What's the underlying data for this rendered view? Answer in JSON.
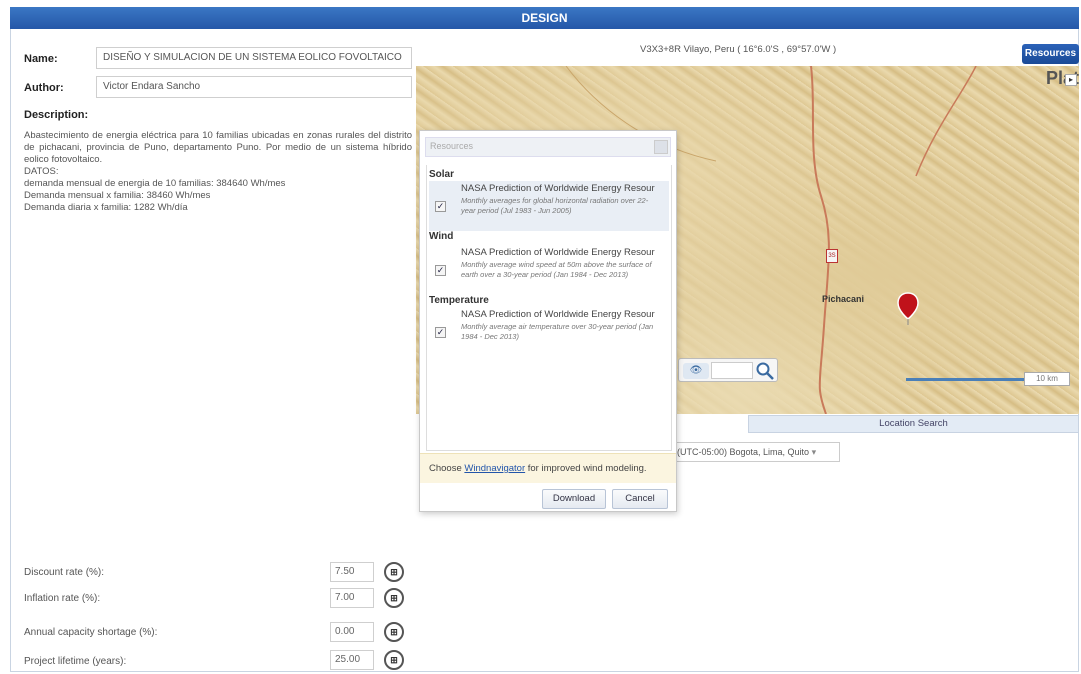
{
  "header": {
    "title": "DESIGN"
  },
  "form": {
    "name_label": "Name:",
    "name_value": "DISEÑO Y SIMULACION DE UN SISTEMA EOLICO FOVOLTAICO",
    "author_label": "Author:",
    "author_value": "Victor Endara Sancho",
    "description_label": "Description:",
    "description_lines": [
      "Abastecimiento de energia eléctrica para 10 familias ubicadas en zonas rurales del distrito de pichacani, provincia de Puno, departamento Puno. Por medio de un sistema híbrido eolico fotovoltaico.",
      "DATOS:",
      "demanda mensual de energia de 10 familias: 384640 Wh/mes",
      "Demanda mensual x familia: 38460 Wh/mes",
      "Demanda diaria x familia: 1282 Wh/día"
    ]
  },
  "economics": [
    {
      "label": "Discount rate (%):",
      "value": "7.50"
    },
    {
      "label": "Inflation rate (%):",
      "value": "7.00"
    },
    {
      "label": "Annual capacity shortage (%):",
      "value": "0.00"
    },
    {
      "label": "Project lifetime (years):",
      "value": "25.00"
    }
  ],
  "location": {
    "coords": "V3X3+8R Vilayo, Peru ( 16°6.0'S , 69°57.0'W )",
    "resources_button": "Resources",
    "map_label": "Plat",
    "place_name": "Pichacani",
    "road_number": "3S",
    "scale_label": "10 km",
    "search_button": "Location Search",
    "timezone": "(UTC-05:00) Bogota, Lima, Quito"
  },
  "dialog": {
    "header_placeholder": "Resources",
    "sections": [
      {
        "title": "Solar",
        "item_title": "NASA Prediction of Worldwide Energy Resour",
        "item_desc": "Monthly averages for global horizontal radiation over 22-year period (Jul 1983 - Jun 2005)",
        "checked": true
      },
      {
        "title": "Wind",
        "item_title": "NASA Prediction of Worldwide Energy Resour",
        "item_desc": "Monthly average wind speed at 50m above the surface of earth over a 30-year period (Jan 1984 - Dec 2013)",
        "checked": true
      },
      {
        "title": "Temperature",
        "item_title": "NASA Prediction of Worldwide Energy Resour",
        "item_desc": "Monthly average air temperature over 30-year period (Jan 1984 - Dec 2013)",
        "checked": true
      }
    ],
    "note_prefix": "Choose ",
    "note_link": "Windnavigator",
    "note_suffix": " for improved wind modeling.",
    "download_button": "Download",
    "cancel_button": "Cancel"
  },
  "colors": {
    "header_blue": "#2c62b3",
    "pin_red": "#c0121b",
    "scale_blue": "#4a7fb8"
  }
}
